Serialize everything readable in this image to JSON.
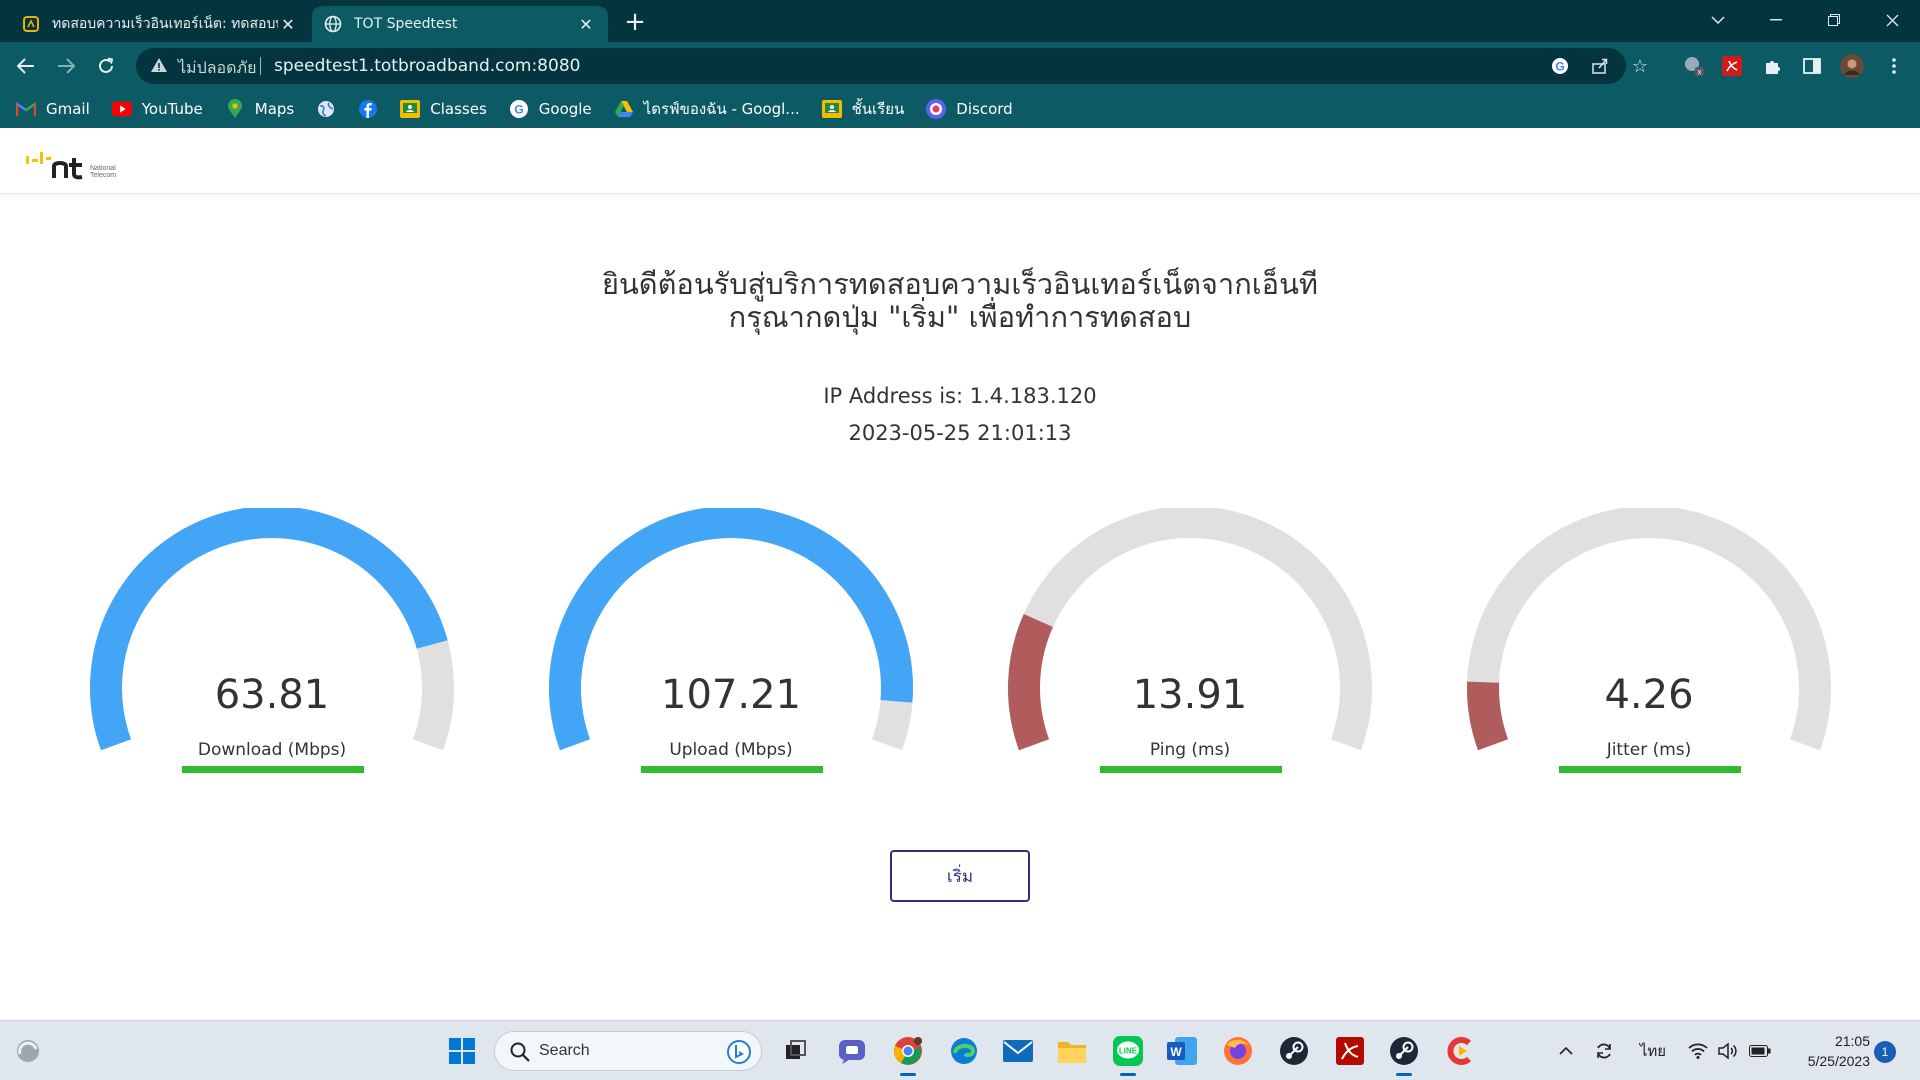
{
  "browser": {
    "tabs": [
      {
        "title": "ทดสอบความเร็วอินเทอร์เน็ต: ทดสอบท",
        "active": false
      },
      {
        "title": "TOT Speedtest",
        "active": true
      }
    ],
    "omnibox": {
      "security_label": "ไม่ปลอดภัย",
      "url": "speedtest1.totbroadband.com:8080"
    },
    "bookmarks": [
      {
        "label": "Gmail",
        "icon": "gmail-icon",
        "color": "#ea4335"
      },
      {
        "label": "YouTube",
        "icon": "youtube-icon",
        "color": "#ff0000"
      },
      {
        "label": "Maps",
        "icon": "maps-icon",
        "color": "#34a853"
      },
      {
        "label": "",
        "icon": "globe-icon",
        "color": "#4a8fe0"
      },
      {
        "label": "",
        "icon": "facebook-icon",
        "color": "#1877f2"
      },
      {
        "label": "Classes",
        "icon": "classroom-icon",
        "color": "#f9bb00"
      },
      {
        "label": "Google",
        "icon": "google-icon",
        "color": "#4285f4"
      },
      {
        "label": "ไดรฟ์ของฉัน - Googl...",
        "icon": "drive-icon",
        "color": "#fbbc04"
      },
      {
        "label": "ชั้นเรียน",
        "icon": "classroom-icon",
        "color": "#f9bb00"
      },
      {
        "label": "Discord",
        "icon": "discord-icon",
        "color": "#5865f2"
      }
    ]
  },
  "page": {
    "welcome_line1": "ยินดีต้อนรับสู่บริการทดสอบความเร็วอินเทอร์เน็ตจากเอ็นที",
    "welcome_line2": "กรุณากดปุ่ม \"เริ่ม\" เพื่อทำการทดสอบ",
    "ip_line": "IP Address is: 1.4.183.120",
    "datetime": "2023-05-25 21:01:13",
    "start_button": "เริ่ม",
    "gauges": [
      {
        "value": "63.81",
        "label": "Download (Mbps)",
        "fill": 0.84,
        "color": "#42a5f5"
      },
      {
        "value": "107.21",
        "label": "Upload (Mbps)",
        "fill": 0.93,
        "color": "#42a5f5"
      },
      {
        "value": "13.91",
        "label": "Ping (ms)",
        "fill": 0.2,
        "color": "#b05c5c"
      },
      {
        "value": "4.26",
        "label": "Jitter (ms)",
        "fill": 0.1,
        "color": "#b05c5c"
      }
    ],
    "gauge_track_color": "#e0e0e0",
    "progress_bar_color": "#2fbd2f"
  },
  "taskbar": {
    "search_placeholder": "Search",
    "apps": [
      "start-icon",
      "search-icon",
      "task-view-icon",
      "teams-chat-icon",
      "chrome-icon",
      "edge-icon",
      "mail-icon",
      "file-explorer-icon",
      "line-icon",
      "word-icon",
      "firefox-icon",
      "steam-icon",
      "acrobat-icon",
      "steam-icon",
      "ccleaner-icon"
    ],
    "language": "ไทย",
    "time": "21:05",
    "date": "5/25/2023",
    "notifications": "1"
  }
}
